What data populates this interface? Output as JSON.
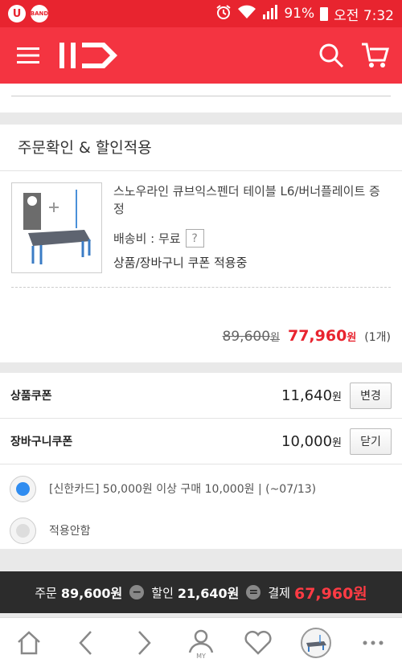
{
  "status_bar": {
    "battery": "91%",
    "time": "오전 7:32",
    "band_label": "BAND",
    "u_label": "U"
  },
  "app_bar": {
    "logo": "11",
    "icons": [
      "menu-icon",
      "search-icon",
      "cart-icon"
    ]
  },
  "order": {
    "title": "주문확인 & 할인적용",
    "product_name": "스노우라인 큐브익스펜더 테이블 L6/버너플레이트 증정",
    "shipping_label": "배송비 : 무료",
    "help_icon": "?",
    "coupon_applied": "상품/장바구니 쿠폰 적용중",
    "original_price": "89,600",
    "original_unit": "원",
    "sale_price": "77,960",
    "sale_unit": "원",
    "quantity": "(1개)"
  },
  "coupons": {
    "product_coupon": {
      "label": "상품쿠폰",
      "amount": "11,640",
      "unit": "원",
      "button": "변경"
    },
    "cart_coupon": {
      "label": "장바구니쿠폰",
      "amount": "10,000",
      "unit": "원",
      "button": "닫기"
    },
    "options": [
      {
        "text": "[신한카드] 50,000원 이상 구매 10,000원 | (~07/13)",
        "selected": true
      },
      {
        "text": "적용안함",
        "selected": false
      }
    ]
  },
  "summary": {
    "order_label": "주문",
    "order_amount": "89,600원",
    "minus": "−",
    "discount_label": "할인",
    "discount_amount": "21,640원",
    "equals": "=",
    "pay_label": "결제",
    "pay_amount": "67,960원"
  },
  "nav": {
    "my_label": "MY"
  },
  "colors": {
    "brand": "#f43441",
    "status": "#e8242f",
    "radio_selected": "#2f8cf0",
    "price": "#e8242f"
  }
}
